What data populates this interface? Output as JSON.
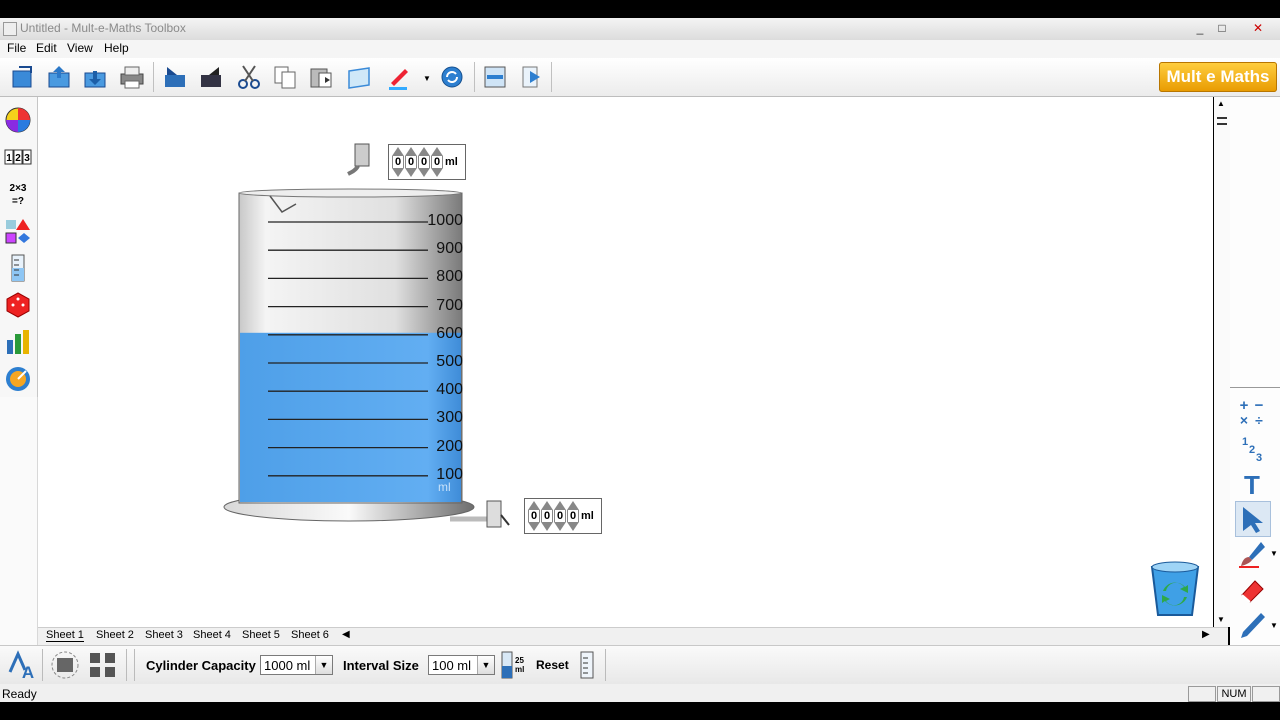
{
  "window": {
    "title": "Untitled - Mult-e-Maths Toolbox",
    "controls": [
      "_",
      "□",
      "✕"
    ]
  },
  "menu": [
    "File",
    "Edit",
    "View",
    "Help"
  ],
  "logo": {
    "text": "Mult e Maths"
  },
  "cylinder": {
    "scale_labels": [
      "1000",
      "900",
      "800",
      "700",
      "600",
      "500",
      "400",
      "300",
      "200",
      "100"
    ],
    "unit_label": "ml",
    "water_level_ml": 600,
    "water_color": "#5aaaf0"
  },
  "top_counter": {
    "digits": [
      "0",
      "0",
      "0",
      "0"
    ],
    "unit": "ml"
  },
  "bottom_counter": {
    "digits": [
      "0",
      "0",
      "0",
      "0"
    ],
    "unit": "ml"
  },
  "sheets": [
    "Sheet 1",
    "Sheet 2",
    "Sheet 3",
    "Sheet 4",
    "Sheet 5",
    "Sheet 6"
  ],
  "bottom": {
    "capacity_label": "Cylinder Capacity",
    "capacity_value": "1000 ml",
    "interval_label": "Interval Size",
    "interval_value": "100 ml",
    "step_badge": "25 ml",
    "reset_label": "Reset"
  },
  "status": {
    "text": "Ready",
    "num": "NUM"
  }
}
